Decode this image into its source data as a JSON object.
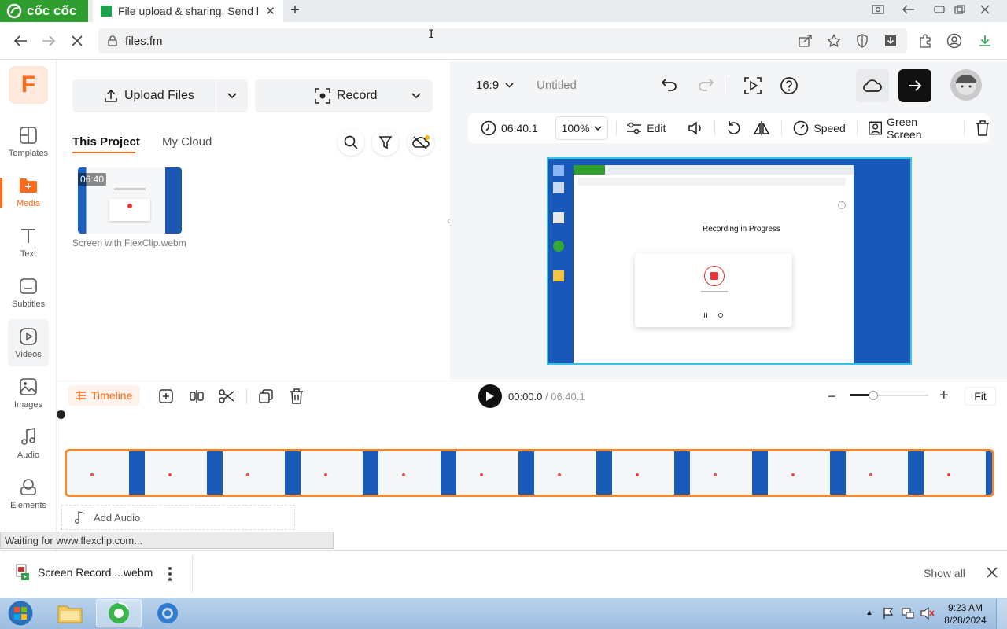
{
  "browser": {
    "brand": "cốc cốc",
    "tab_title": "File upload & sharing. Send l",
    "url": "files.fm",
    "status": "Waiting for www.flexclip.com..."
  },
  "rail": {
    "items": [
      {
        "label": "Templates"
      },
      {
        "label": "Media"
      },
      {
        "label": "Text"
      },
      {
        "label": "Subtitles"
      },
      {
        "label": "Videos"
      },
      {
        "label": "Images"
      },
      {
        "label": "Audio"
      },
      {
        "label": "Elements"
      }
    ]
  },
  "media": {
    "upload_label": "Upload Files",
    "record_label": "Record",
    "tab_project": "This Project",
    "tab_cloud": "My Cloud",
    "thumb_duration": "06:40",
    "thumb_name": "Screen with FlexClip.webm"
  },
  "editor": {
    "aspect": "16:9",
    "project_name": "Untitled",
    "duration": "06:40.1",
    "zoom": "100%",
    "edit_label": "Edit",
    "speed_label": "Speed",
    "green_screen_label": "Green Screen",
    "preview_title": "Recording in Progress"
  },
  "timeline": {
    "label": "Timeline",
    "current_time": "00:00.0",
    "total_time": "/ 06:40.1",
    "fit_label": "Fit",
    "add_audio": "Add Audio"
  },
  "downloads": {
    "file_name": "Screen Record....webm",
    "show_all": "Show all"
  },
  "taskbar": {
    "time": "9:23 AM",
    "date": "8/28/2024"
  }
}
